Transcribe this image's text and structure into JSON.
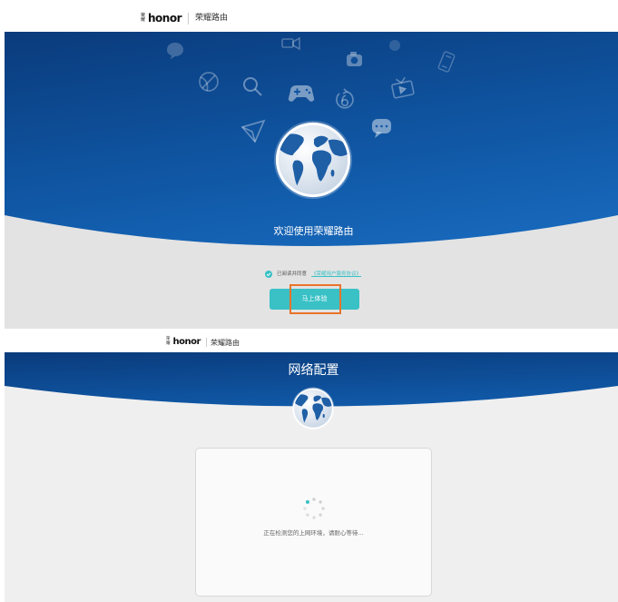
{
  "colors": {
    "banner_dark": "#0a3b7c",
    "banner_mid": "#1058a6",
    "banner_light": "#1b6fc4",
    "accent_teal": "#39c1c6",
    "highlight_orange": "#e8742c",
    "welcome_gray": "#e3e3e3",
    "config_gray": "#efefef",
    "globe_land": "#1f5fa6"
  },
  "welcome_screen": {
    "header": {
      "logo_cn": "荣耀",
      "logo_text": "honor",
      "product_name": "荣耀路由"
    },
    "banner": {
      "icons": [
        "chat-cloud-icon",
        "video-icon",
        "camera-icon",
        "dot-icon",
        "phone-icon",
        "basketball-icon",
        "search-icon",
        "gamepad-icon",
        "replay-icon",
        "tv-icon",
        "paper-plane-icon",
        "chat-icon",
        "globe-icon"
      ],
      "welcome_text": "欢迎使用荣耀路由"
    },
    "agreement": {
      "checked": true,
      "label": "已阅读并同意",
      "link_text": "《荣耀用户服务协议》"
    },
    "start_button": {
      "label": "马上体验",
      "highlighted": true
    }
  },
  "config_screen": {
    "header": {
      "logo_cn": "荣耀",
      "logo_text": "honor",
      "product_name": "荣耀路由"
    },
    "banner": {
      "title": "网络配置",
      "icons": [
        "globe-icon"
      ]
    },
    "status_card": {
      "loading": true,
      "message": "正在检测您的上网环境，请耐心等待..."
    }
  }
}
